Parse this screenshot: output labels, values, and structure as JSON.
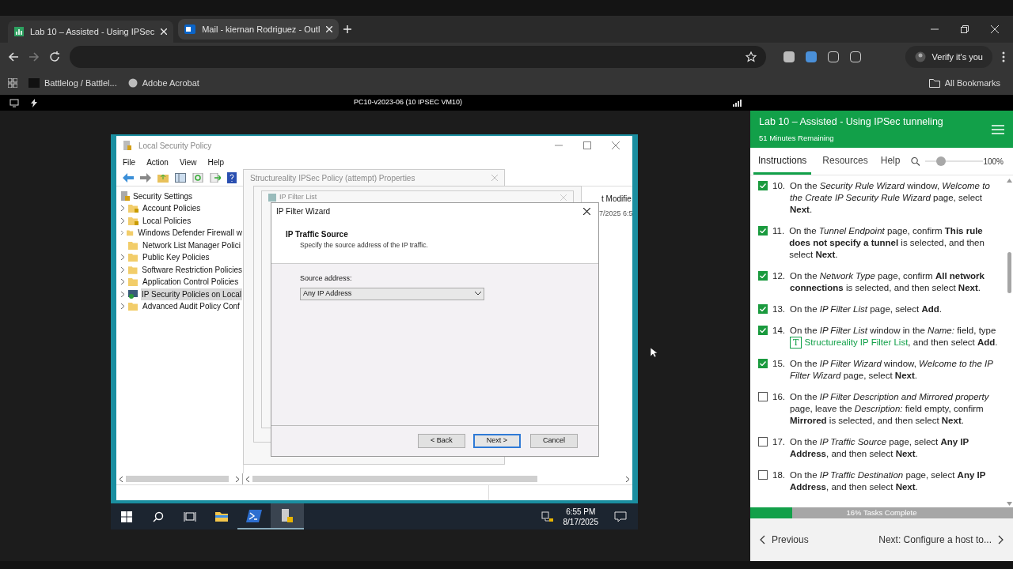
{
  "browser": {
    "tabs": [
      {
        "title": "Lab 10 – Assisted - Using IPSec",
        "selected": true
      },
      {
        "title": "Mail - kiernan Rodriguez - Outl",
        "selected": false
      }
    ],
    "verify": "Verify it's you",
    "bookmarks": [
      "Battlelog / Battlel...",
      "Adobe Acrobat"
    ],
    "all_bookmarks": "All Bookmarks"
  },
  "remote_bar": {
    "title": "PC10-v2023-06 (10 IPSEC VM10)"
  },
  "mmc": {
    "title": "Local Security Policy",
    "menu": [
      "File",
      "Action",
      "View",
      "Help"
    ],
    "tree_root": "Security Settings",
    "tree": [
      {
        "label": "Account Policies",
        "expandable": true,
        "selected": false
      },
      {
        "label": "Local Policies",
        "expandable": true,
        "selected": false
      },
      {
        "label": "Windows Defender Firewall w",
        "expandable": true,
        "selected": false
      },
      {
        "label": "Network List Manager Polici",
        "expandable": false,
        "selected": false
      },
      {
        "label": "Public Key Policies",
        "expandable": true,
        "selected": false
      },
      {
        "label": "Software Restriction Policies",
        "expandable": true,
        "selected": false
      },
      {
        "label": "Application Control Policies",
        "expandable": true,
        "selected": false
      },
      {
        "label": "IP Security Policies on Local",
        "expandable": true,
        "selected": true
      },
      {
        "label": "Advanced Audit Policy Conf",
        "expandable": true,
        "selected": false
      }
    ],
    "column_header": "t Modifie",
    "cell": "7/2025 6:5",
    "properties_title": "Structureality IPSec Policy (attempt) Properties",
    "filter_list_title": "IP Filter List"
  },
  "wizard": {
    "title": "IP Filter Wizard",
    "heading": "IP Traffic Source",
    "subheading": "Specify the source address of the IP traffic.",
    "field_label": "Source address:",
    "field_value": "Any IP Address",
    "buttons": [
      {
        "label": "< Back",
        "default": false
      },
      {
        "label": "Next >",
        "default": true
      },
      {
        "label": "Cancel",
        "default": false
      }
    ]
  },
  "taskbar": {
    "time": "6:55 PM",
    "date": "8/17/2025"
  },
  "lab": {
    "title": "Lab 10 – Assisted - Using IPSec tunneling",
    "timer": "51 Minutes Remaining",
    "tabs": [
      {
        "label": "Instructions",
        "selected": true
      },
      {
        "label": "Resources",
        "selected": false
      },
      {
        "label": "Help",
        "selected": false
      }
    ],
    "zoom": {
      "level": 0.2,
      "reading": "100%"
    },
    "steps": [
      {
        "number": "10.",
        "checked": true,
        "text": "On the *Security Rule Wizard* window, *Welcome to the Create IP Security Rule Wizard* page, select **Next**."
      },
      {
        "number": "11.",
        "checked": true,
        "text": "On the *Tunnel Endpoint* page, confirm **This rule does not specify a tunnel** is selected, and then select **Next**."
      },
      {
        "number": "12.",
        "checked": true,
        "text": "On the *Network Type* page, confirm **All network connections** is selected, and then select **Next**."
      },
      {
        "number": "13.",
        "checked": true,
        "text": "On the *IP Filter List* page, select **Add**."
      },
      {
        "number": "14.",
        "checked": true,
        "text": "On the *IP Filter List* window in the *Name:* field, type",
        "typed_mark": "T",
        "typed": "Structureality IP Filter List",
        "text_after": ", and then select **Add**."
      },
      {
        "number": "15.",
        "checked": true,
        "text": "On the *IP Filter Wizard* window, *Welcome to the IP Filter Wizard* page, select **Next**."
      },
      {
        "number": "16.",
        "checked": false,
        "text": "On the *IP Filter Description and Mirrored property* page, leave the *Description:* field empty, confirm **Mirrored** is selected, and then select **Next**."
      },
      {
        "number": "17.",
        "checked": false,
        "text": "On the *IP Traffic Source* page, select **Any IP Address**, and then select **Next**."
      },
      {
        "number": "18.",
        "checked": false,
        "text": "On the *IP Traffic Destination* page, select **Any IP Address**, and then select **Next**."
      }
    ],
    "progress": {
      "level": 0.16,
      "label": "16% Tasks Complete"
    },
    "previous": "Previous",
    "next": "Next: Configure a host to..."
  }
}
